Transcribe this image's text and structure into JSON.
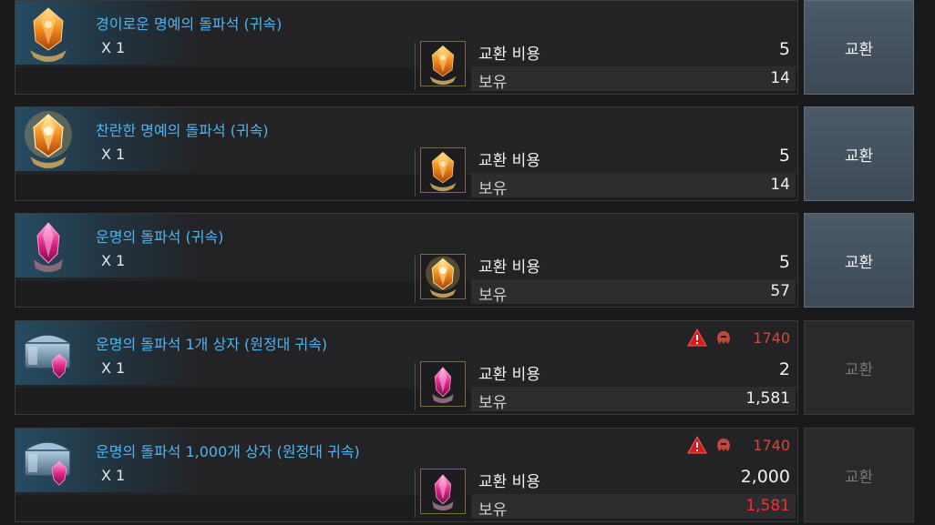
{
  "rows": [
    {
      "name": "경이로운 명예의 돌파석 (귀속)",
      "qty": "X 1",
      "icon": "orange-honor-stone-icon",
      "cost_label": "교환 비용",
      "cost": "5",
      "own_label": "보유",
      "own": "14",
      "own_insufficient": false,
      "cost_icon": "orange-honor-stone-icon",
      "button": "교환",
      "enabled": true
    },
    {
      "name": "찬란한 명예의 돌파석 (귀속)",
      "qty": "X 1",
      "icon": "radiant-honor-stone-icon",
      "cost_label": "교환 비용",
      "cost": "5",
      "own_label": "보유",
      "own": "14",
      "own_insufficient": false,
      "cost_icon": "orange-honor-stone-icon",
      "button": "교환",
      "enabled": true
    },
    {
      "name": "운명의 돌파석 (귀속)",
      "qty": "X 1",
      "icon": "pink-destiny-stone-icon",
      "cost_label": "교환 비용",
      "cost": "5",
      "own_label": "보유",
      "own": "57",
      "own_insufficient": false,
      "cost_icon": "radiant-honor-stone-icon",
      "button": "교환",
      "enabled": true
    },
    {
      "name": "운명의 돌파석 1개 상자 (원정대 귀속)",
      "qty": "X 1",
      "icon": "chest-destiny-stone-icon",
      "cost_label": "교환 비용",
      "cost": "2",
      "own_label": "보유",
      "own": "1,581",
      "own_insufficient": false,
      "cost_icon": "pink-destiny-stone-icon",
      "requirement": "1740",
      "button": "교환",
      "enabled": false
    },
    {
      "name": "운명의 돌파석 1,000개 상자 (원정대 귀속)",
      "qty": "X 1",
      "icon": "chest-destiny-stone-icon",
      "cost_label": "교환 비용",
      "cost": "2,000",
      "own_label": "보유",
      "own": "1,581",
      "own_insufficient": true,
      "cost_icon": "pink-destiny-stone-icon",
      "requirement": "1740",
      "button": "교환",
      "enabled": false
    }
  ],
  "colors": {
    "item_name": "#4fb3f0",
    "requirement": "#d04a3a",
    "insufficient": "#ff2a2a"
  }
}
